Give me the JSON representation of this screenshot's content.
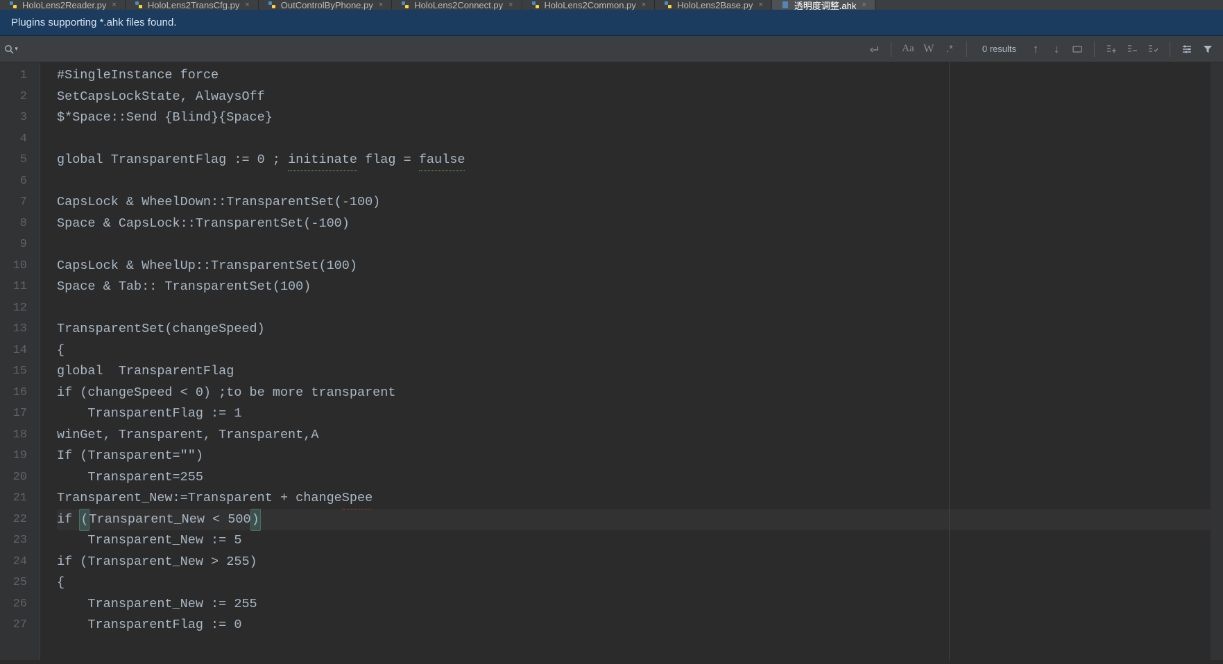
{
  "tabs": [
    {
      "name": "HoloLens2Reader.py"
    },
    {
      "name": "HoloLens2TransCfg.py"
    },
    {
      "name": "OutControlByPhone.py"
    },
    {
      "name": "HoloLens2Connect.py"
    },
    {
      "name": "HoloLens2Common.py"
    },
    {
      "name": "HoloLens2Base.py"
    },
    {
      "name": "透明度调整.ahk",
      "active": true
    }
  ],
  "notice": "Plugins supporting *.ahk files found.",
  "find": {
    "placeholder": "",
    "results": "0 results",
    "icons": {
      "search": "search-icon",
      "newline": "↵",
      "case": "Aa",
      "word": "W",
      "regex": ".*",
      "prev": "↑",
      "next": "↓",
      "select": "select-all-icon",
      "add_sel": "add-selection-icon",
      "remove_sel": "remove-selection-icon",
      "select_occ": "select-occurrences-icon",
      "settings": "settings-icon",
      "filter": "filter-icon"
    }
  },
  "lines": [
    {
      "n": 1,
      "txt": "#SingleInstance force"
    },
    {
      "n": 2,
      "txt": "SetCapsLockState, AlwaysOff"
    },
    {
      "n": 3,
      "txt": "$*Space::Send {Blind}{Space}"
    },
    {
      "n": 4,
      "txt": ""
    },
    {
      "n": 5,
      "txt": "global TransparentFlag := 0 ; ",
      "typo1": "initinate",
      "mid": " flag = ",
      "typo2": "faulse"
    },
    {
      "n": 6,
      "txt": ""
    },
    {
      "n": 7,
      "txt": "CapsLock & WheelDown::TransparentSet(-100)"
    },
    {
      "n": 8,
      "txt": "Space & CapsLock::TransparentSet(-100)"
    },
    {
      "n": 9,
      "txt": ""
    },
    {
      "n": 10,
      "txt": "CapsLock & WheelUp::TransparentSet(100)"
    },
    {
      "n": 11,
      "txt": "Space & Tab:: TransparentSet(100)"
    },
    {
      "n": 12,
      "txt": ""
    },
    {
      "n": 13,
      "txt": "TransparentSet(changeSpeed)"
    },
    {
      "n": 14,
      "txt": "{"
    },
    {
      "n": 15,
      "txt": "global  TransparentFlag"
    },
    {
      "n": 16,
      "txt": "if (changeSpeed < 0) ;to be more transparent"
    },
    {
      "n": 17,
      "txt": "    TransparentFlag := 1"
    },
    {
      "n": 18,
      "txt": "winGet, Transparent, Transparent,A"
    },
    {
      "n": 19,
      "txt": "If (Transparent=\"\")"
    },
    {
      "n": 20,
      "txt": "    Transparent=255"
    },
    {
      "n": 21,
      "txt": "Transparent_New:=Transparent + change",
      "err": "Spee"
    },
    {
      "n": 22,
      "txt_pre": "if ",
      "b1": "(",
      "mid": "Transparent_New < 500",
      "b2": ")",
      "hl": true
    },
    {
      "n": 23,
      "txt": "    Transparent_New := 5"
    },
    {
      "n": 24,
      "txt": "if (Transparent_New > 255)"
    },
    {
      "n": 25,
      "txt": "{"
    },
    {
      "n": 26,
      "txt": "    Transparent_New := 255"
    },
    {
      "n": 27,
      "txt": "    TransparentFlag := 0"
    }
  ]
}
